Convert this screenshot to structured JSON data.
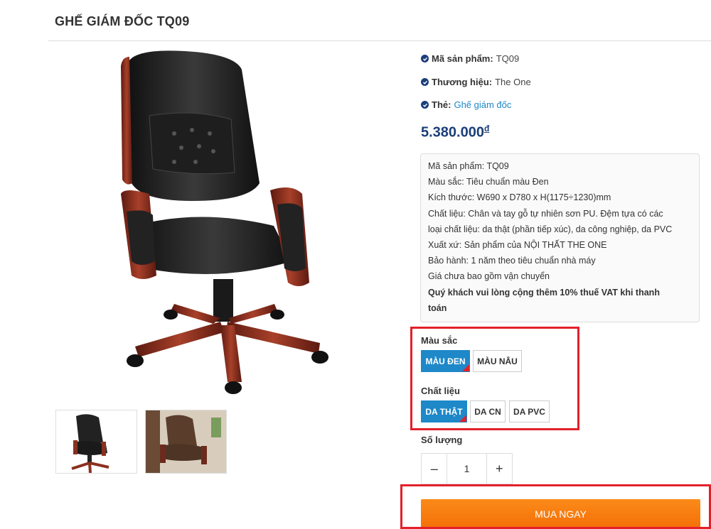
{
  "product": {
    "title": "GHẾ GIÁM ĐỐC TQ09",
    "meta": [
      {
        "key": "Mã sản phẩm:",
        "value": "TQ09"
      },
      {
        "key": "Thương hiệu:",
        "value": "The One"
      },
      {
        "key": "Thẻ:",
        "value": "Ghế giám đốc"
      }
    ],
    "price": "5.380.000",
    "currency": "đ",
    "description": [
      "Mã sản phẩm: TQ09",
      "Màu sắc: Tiêu chuẩn màu Đen",
      "Kích thước: W690 x D780 x H(1175÷1230)mm",
      "Chất liệu: Chân và tay gỗ tự nhiên sơn PU. Đệm tựa có các",
      "loại chất liệu: da thật (phần tiếp xúc), da công nghiệp, da PVC",
      "Xuất xứ: Sản phẩm của NỘI THẤT THE ONE",
      "Bảo hành: 1 năm theo tiêu chuẩn nhà máy",
      "Giá chưa bao gồm vận chuyển",
      "Quý khách vui lòng cộng thêm 10% thuế VAT khi thanh",
      "toán"
    ]
  },
  "options": {
    "color_label": "Màu sắc",
    "colors": [
      "MÀU ĐEN",
      "MÀU NÂU"
    ],
    "material_label": "Chất liệu",
    "materials": [
      "DA THẬT",
      "DA CN",
      "DA PVC"
    ]
  },
  "quantity": {
    "label": "Số lượng",
    "minus": "–",
    "value": "1",
    "plus": "+"
  },
  "buy_label": "MUA NGAY",
  "colors": {
    "accent_blue": "#1e88c9",
    "price_navy": "#1c3f7a",
    "buy_orange": "#f47b0c",
    "highlight_red": "#e3202b"
  }
}
